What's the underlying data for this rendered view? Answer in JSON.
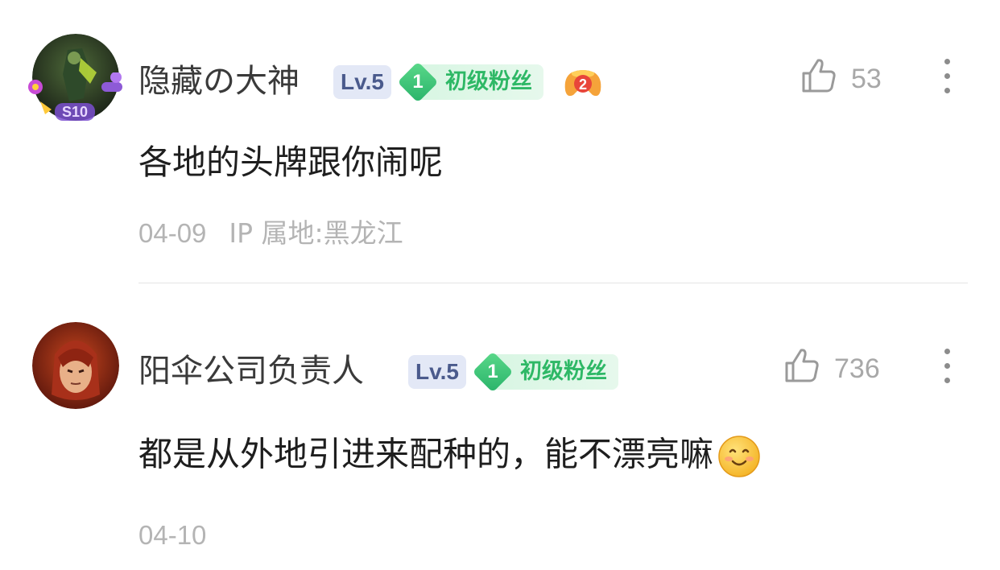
{
  "comments": [
    {
      "username": "隐藏の大神",
      "level": "Lv.5",
      "fan_level": "1",
      "fan_title": "初级粉丝",
      "gamer_badge_num": "2",
      "avatar_badge": "S10",
      "likes": "53",
      "content": "各地的头牌跟你闹呢",
      "date": "04-09",
      "ip_location": "IP 属地:黑龙江"
    },
    {
      "username": "阳伞公司负责人",
      "level": "Lv.5",
      "fan_level": "1",
      "fan_title": "初级粉丝",
      "likes": "736",
      "content": "都是从外地引进来配种的，能不漂亮嘛",
      "emoji": "smile-emoji",
      "date": "04-10"
    }
  ],
  "icons": {
    "like": "thumbs-up-icon",
    "more": "more-vertical-icon"
  },
  "colors": {
    "fan_badge_green": "#2eb866",
    "level_badge_bg": "#e3e8f6",
    "level_badge_text": "#4a5a8c",
    "meta_gray": "#b4b4b4"
  }
}
